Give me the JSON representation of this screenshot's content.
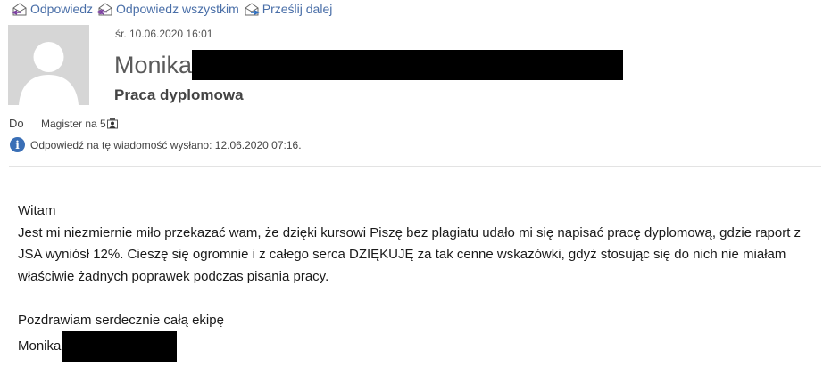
{
  "toolbar": {
    "reply_label": "Odpowiedz",
    "reply_all_label": "Odpowiedz wszystkim",
    "forward_label": "Prześlij dalej"
  },
  "header": {
    "date": "śr. 10.06.2020 16:01",
    "sender_first_name": "Monika",
    "subject": "Praca dyplomowa",
    "to_label": "Do",
    "to_value": "Magister na 5",
    "info_text": "Odpowiedź na tę wiadomość wysłano: 12.06.2020 07:16."
  },
  "body": {
    "greeting": "Witam",
    "paragraph": "Jest mi niezmiernie miło przekazać wam, że dzięki kursowi Piszę bez plagiatu udało mi się napisać pracę dyplomową, gdzie raport z JSA wyniósł 12%. Cieszę się ogromnie i z całego serca DZIĘKUJĘ za tak cenne wskazówki, gdyż stosując się do nich nie miałam właściwie żadnych poprawek podczas pisania pracy.",
    "closing": "Pozdrawiam serdecznie całą ekipę",
    "signature_first_name": "Monika"
  },
  "icons": {
    "reply": "reply-envelope-icon",
    "reply_all": "reply-all-envelope-icon",
    "forward": "forward-envelope-icon",
    "info": "info-icon",
    "contact": "contact-card-icon"
  },
  "colors": {
    "accent": "#3a6fb6",
    "reply_arrow": "#7b3fa0",
    "forward_arrow": "#2f6fc0",
    "redaction": "#000000"
  }
}
